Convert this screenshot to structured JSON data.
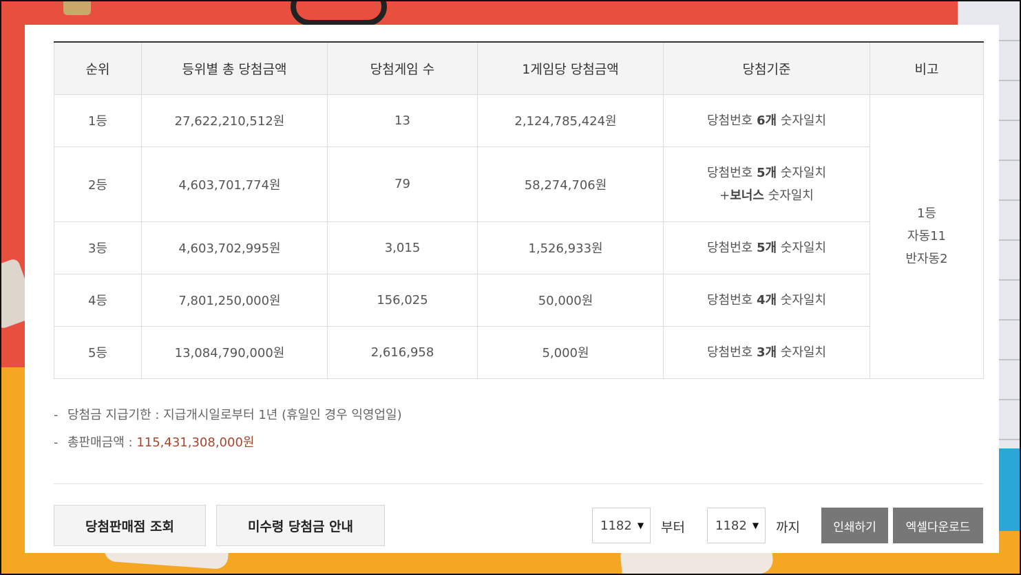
{
  "table": {
    "headers": [
      "순위",
      "등위별 총 당첨금액",
      "당첨게임 수",
      "1게임당 당첨금액",
      "당첨기준",
      "비고"
    ],
    "rows": [
      {
        "rank": "1등",
        "total": "27,622,210,512원",
        "games": "13",
        "per_game": "2,124,785,424원",
        "crit_pre": "당첨번호 ",
        "crit_bold": "6개",
        "crit_post": " 숫자일치"
      },
      {
        "rank": "2등",
        "total": "4,603,701,774원",
        "games": "79",
        "per_game": "58,274,706원",
        "crit_pre": "당첨번호 ",
        "crit_bold": "5개",
        "crit_post": " 숫자일치",
        "crit2_pre": "+",
        "crit2_bold": "보너스",
        "crit2_post": " 숫자일치"
      },
      {
        "rank": "3등",
        "total": "4,603,702,995원",
        "games": "3,015",
        "per_game": "1,526,933원",
        "crit_pre": "당첨번호 ",
        "crit_bold": "5개",
        "crit_post": " 숫자일치"
      },
      {
        "rank": "4등",
        "total": "7,801,250,000원",
        "games": "156,025",
        "per_game": "50,000원",
        "crit_pre": "당첨번호 ",
        "crit_bold": "4개",
        "crit_post": " 숫자일치"
      },
      {
        "rank": "5등",
        "total": "13,084,790,000원",
        "games": "2,616,958",
        "per_game": "5,000원",
        "crit_pre": "당첨번호 ",
        "crit_bold": "3개",
        "crit_post": " 숫자일치"
      }
    ],
    "note": {
      "line1": "1등",
      "line2": "자동11",
      "line3": "반자동2"
    }
  },
  "info": {
    "dash": "-",
    "deadline_label": "당첨금 지급기한 : 지급개시일로부터 1년 (휴일인 경우 익영업일)",
    "sales_label": "총판매금액 : ",
    "sales_value": "115,431,308,000원"
  },
  "buttons": {
    "stores": "당첨판매점 조회",
    "unclaimed": "미수령 당첨금 안내",
    "print": "인쇄하기",
    "excel": "엑셀다운로드"
  },
  "range": {
    "from_value": "1182",
    "from_label": "부터",
    "to_value": "1182",
    "to_label": "까지"
  },
  "colors": {
    "money": "#a8452e",
    "dark_button": "#777777",
    "header_bg": "#f4f4f4"
  }
}
